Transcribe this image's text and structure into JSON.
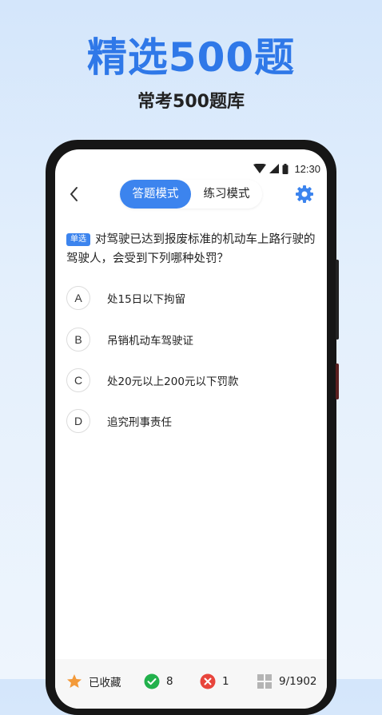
{
  "headline": "精选500题",
  "subline": "常考500题库",
  "status_bar": {
    "time": "12:30"
  },
  "header": {
    "modes": [
      {
        "label": "答题模式",
        "active": true
      },
      {
        "label": "练习模式",
        "active": false
      }
    ]
  },
  "question": {
    "type_tag": "单选",
    "text": "对驾驶已达到报废标准的机动车上路行驶的驾驶人，会受到下列哪种处罚？"
  },
  "options": [
    {
      "letter": "A",
      "text": "处15日以下拘留"
    },
    {
      "letter": "B",
      "text": "吊销机动车驾驶证"
    },
    {
      "letter": "C",
      "text": "处20元以上200元以下罚款"
    },
    {
      "letter": "D",
      "text": "追究刑事责任"
    }
  ],
  "bottom_bar": {
    "favorite_label": "已收藏",
    "correct_count": "8",
    "wrong_count": "1",
    "progress": "9/1902"
  },
  "colors": {
    "accent": "#3c84ee",
    "headline": "#2f78e8",
    "star": "#f39a3a",
    "correct": "#22b14c",
    "wrong": "#e8453c"
  }
}
